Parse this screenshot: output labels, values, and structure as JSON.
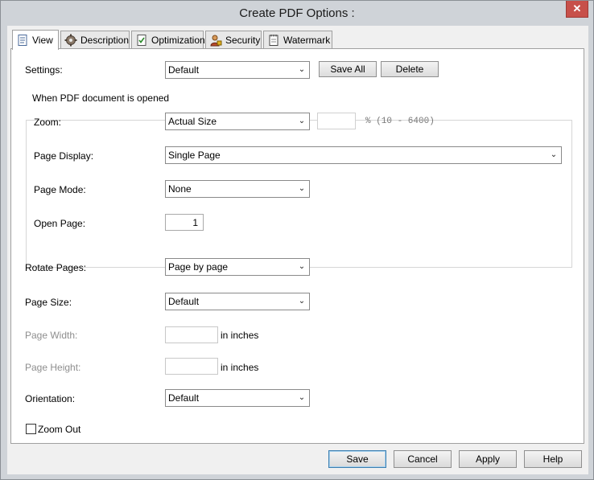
{
  "window": {
    "title": "Create PDF Options :",
    "close_glyph": "✕"
  },
  "tabs": [
    {
      "label": "View",
      "icon": "document-icon",
      "active": true
    },
    {
      "label": "Description",
      "icon": "gear-icon",
      "active": false
    },
    {
      "label": "Optimization",
      "icon": "checklist-icon",
      "active": false
    },
    {
      "label": "Security",
      "icon": "user-lock-icon",
      "active": false
    },
    {
      "label": "Watermark",
      "icon": "notepad-icon",
      "active": false
    }
  ],
  "settings": {
    "label": "Settings:",
    "value": "Default",
    "save_all": "Save All",
    "delete": "Delete"
  },
  "open_group": {
    "caption": "When PDF document is opened",
    "zoom": {
      "label": "Zoom:",
      "value": "Actual Size",
      "percent_value": "",
      "range_hint": "% (10 - 6400)"
    },
    "page_display": {
      "label": "Page Display:",
      "value": "Single Page"
    },
    "page_mode": {
      "label": "Page Mode:",
      "value": "None"
    },
    "open_page": {
      "label": "Open Page:",
      "value": "1"
    }
  },
  "rotate_pages": {
    "label": "Rotate Pages:",
    "value": "Page by page"
  },
  "page_size": {
    "label": "Page Size:",
    "value": "Default"
  },
  "page_width": {
    "label": "Page Width:",
    "value": "",
    "unit": "in inches"
  },
  "page_height": {
    "label": "Page Height:",
    "value": "",
    "unit": "in inches"
  },
  "orientation": {
    "label": "Orientation:",
    "value": "Default"
  },
  "zoom_out": {
    "label": "Zoom Out",
    "checked": false
  },
  "buttons": {
    "save": "Save",
    "cancel": "Cancel",
    "apply": "Apply",
    "help": "Help"
  },
  "dropdown_glyph": "⌄"
}
